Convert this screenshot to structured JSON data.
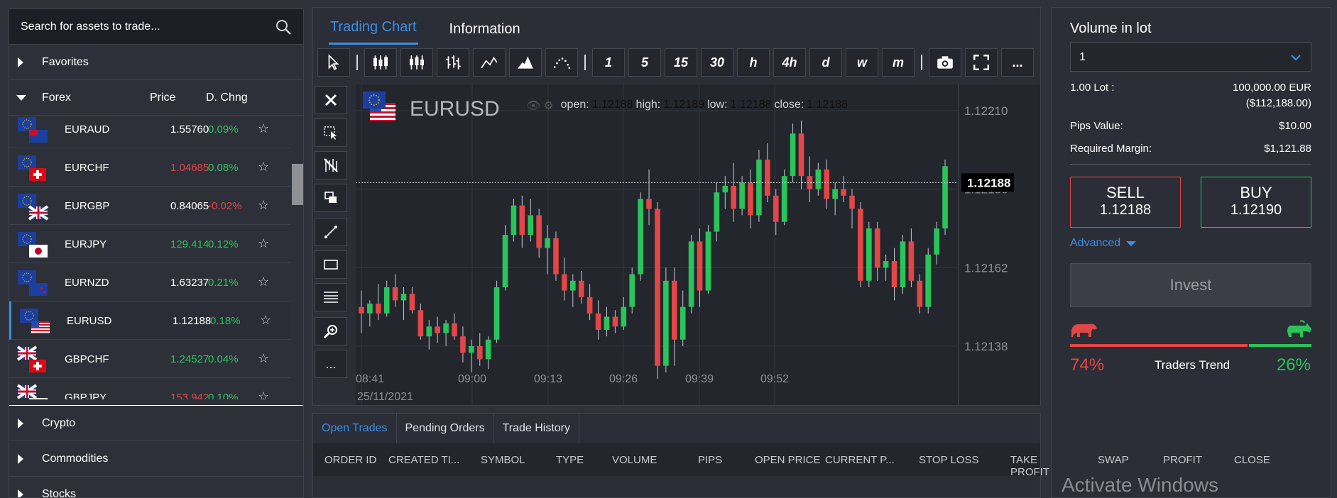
{
  "search": {
    "placeholder": "Search for assets to trade..."
  },
  "categories": {
    "favorites": "Favorites",
    "forex": "Forex",
    "crypto": "Crypto",
    "commodities": "Commodities",
    "stocks": "Stocks"
  },
  "forex_headers": {
    "price": "Price",
    "change": "D. Chng"
  },
  "forex_rows": [
    {
      "symbol": "EURAUD",
      "price": "1.55760",
      "price_color": "white",
      "change": "0.09%",
      "change_color": "green"
    },
    {
      "symbol": "EURCHF",
      "price": "1.04685",
      "price_color": "red",
      "change": "0.08%",
      "change_color": "green"
    },
    {
      "symbol": "EURGBP",
      "price": "0.84065",
      "price_color": "white",
      "change": "-0.02%",
      "change_color": "red"
    },
    {
      "symbol": "EURJPY",
      "price": "129.414",
      "price_color": "green",
      "change": "0.12%",
      "change_color": "green"
    },
    {
      "symbol": "EURNZD",
      "price": "1.63237",
      "price_color": "white",
      "change": "0.21%",
      "change_color": "green"
    },
    {
      "symbol": "EURUSD",
      "price": "1.12188",
      "price_color": "white",
      "change": "0.18%",
      "change_color": "green"
    },
    {
      "symbol": "GBPCHF",
      "price": "1.24527",
      "price_color": "green",
      "change": "0.04%",
      "change_color": "green"
    },
    {
      "symbol": "GBPJPY",
      "price": "153.942",
      "price_color": "red",
      "change": "0.10%",
      "change_color": "green"
    }
  ],
  "center_tabs": {
    "chart": "Trading Chart",
    "info": "Information"
  },
  "timeframes": [
    "1",
    "5",
    "15",
    "30",
    "h",
    "4h",
    "d",
    "w",
    "m"
  ],
  "toolbar_more": "...",
  "sidetools_more": "...",
  "chart": {
    "symbol": "EURUSD",
    "ohlc_labels": {
      "open": "open:",
      "high": "high:",
      "low": "low:",
      "close": "close:"
    },
    "ohlc_values": {
      "open": "1.12188",
      "high": "1.12189",
      "low": "1.12188",
      "close": "1.12188"
    },
    "current_price": "1.12188",
    "date_label": "25/11/2021"
  },
  "chart_data": {
    "type": "candlestick",
    "y_ticks": [
      "1.12210",
      "1.12186",
      "1.12162",
      "1.12138"
    ],
    "x_ticks": [
      "08:41",
      "09:00",
      "09:13",
      "09:26",
      "09:39",
      "09:52"
    ],
    "ylim": [
      1.1212,
      1.12218
    ],
    "candles": [
      {
        "o": 1.1215,
        "h": 1.12155,
        "l": 1.12142,
        "c": 1.12148
      },
      {
        "o": 1.12148,
        "h": 1.12152,
        "l": 1.12144,
        "c": 1.12151
      },
      {
        "o": 1.12151,
        "h": 1.12157,
        "l": 1.12146,
        "c": 1.12148
      },
      {
        "o": 1.12148,
        "h": 1.12158,
        "l": 1.12147,
        "c": 1.12156
      },
      {
        "o": 1.12156,
        "h": 1.1216,
        "l": 1.1215,
        "c": 1.12152
      },
      {
        "o": 1.12152,
        "h": 1.12156,
        "l": 1.12146,
        "c": 1.12154
      },
      {
        "o": 1.12154,
        "h": 1.12156,
        "l": 1.12148,
        "c": 1.12149
      },
      {
        "o": 1.12149,
        "h": 1.12151,
        "l": 1.1214,
        "c": 1.12141
      },
      {
        "o": 1.12141,
        "h": 1.12146,
        "l": 1.12137,
        "c": 1.12144
      },
      {
        "o": 1.12144,
        "h": 1.12147,
        "l": 1.12139,
        "c": 1.12142
      },
      {
        "o": 1.12142,
        "h": 1.12146,
        "l": 1.12138,
        "c": 1.12145
      },
      {
        "o": 1.12145,
        "h": 1.12148,
        "l": 1.1214,
        "c": 1.12141
      },
      {
        "o": 1.12141,
        "h": 1.12144,
        "l": 1.12133,
        "c": 1.12136
      },
      {
        "o": 1.12136,
        "h": 1.1214,
        "l": 1.1213,
        "c": 1.12138
      },
      {
        "o": 1.12138,
        "h": 1.12142,
        "l": 1.12132,
        "c": 1.12134
      },
      {
        "o": 1.12134,
        "h": 1.12141,
        "l": 1.12131,
        "c": 1.1214
      },
      {
        "o": 1.1214,
        "h": 1.12158,
        "l": 1.12139,
        "c": 1.12156
      },
      {
        "o": 1.12156,
        "h": 1.12175,
        "l": 1.12155,
        "c": 1.12172
      },
      {
        "o": 1.12172,
        "h": 1.12183,
        "l": 1.1217,
        "c": 1.12181
      },
      {
        "o": 1.12181,
        "h": 1.12184,
        "l": 1.12168,
        "c": 1.12172
      },
      {
        "o": 1.12172,
        "h": 1.12183,
        "l": 1.1217,
        "c": 1.12178
      },
      {
        "o": 1.12178,
        "h": 1.1218,
        "l": 1.12165,
        "c": 1.12168
      },
      {
        "o": 1.12168,
        "h": 1.12175,
        "l": 1.1216,
        "c": 1.12171
      },
      {
        "o": 1.12171,
        "h": 1.12173,
        "l": 1.12158,
        "c": 1.1216
      },
      {
        "o": 1.1216,
        "h": 1.12165,
        "l": 1.12152,
        "c": 1.12155
      },
      {
        "o": 1.12155,
        "h": 1.1216,
        "l": 1.1215,
        "c": 1.12158
      },
      {
        "o": 1.12158,
        "h": 1.12161,
        "l": 1.12151,
        "c": 1.12153
      },
      {
        "o": 1.12153,
        "h": 1.12157,
        "l": 1.12146,
        "c": 1.12148
      },
      {
        "o": 1.12148,
        "h": 1.12152,
        "l": 1.1214,
        "c": 1.12143
      },
      {
        "o": 1.12143,
        "h": 1.1215,
        "l": 1.12141,
        "c": 1.12147
      },
      {
        "o": 1.12147,
        "h": 1.12149,
        "l": 1.12142,
        "c": 1.12144
      },
      {
        "o": 1.12144,
        "h": 1.12153,
        "l": 1.12143,
        "c": 1.1215
      },
      {
        "o": 1.1215,
        "h": 1.12162,
        "l": 1.12148,
        "c": 1.1216
      },
      {
        "o": 1.1216,
        "h": 1.12185,
        "l": 1.12158,
        "c": 1.12183
      },
      {
        "o": 1.12183,
        "h": 1.12192,
        "l": 1.12175,
        "c": 1.1218
      },
      {
        "o": 1.1218,
        "h": 1.12182,
        "l": 1.12128,
        "c": 1.12132
      },
      {
        "o": 1.12132,
        "h": 1.12162,
        "l": 1.1213,
        "c": 1.12158
      },
      {
        "o": 1.12158,
        "h": 1.12162,
        "l": 1.12132,
        "c": 1.1214
      },
      {
        "o": 1.1214,
        "h": 1.12155,
        "l": 1.12138,
        "c": 1.1215
      },
      {
        "o": 1.1215,
        "h": 1.12172,
        "l": 1.12148,
        "c": 1.1217
      },
      {
        "o": 1.1217,
        "h": 1.12174,
        "l": 1.1215,
        "c": 1.12155
      },
      {
        "o": 1.12155,
        "h": 1.12175,
        "l": 1.12154,
        "c": 1.12173
      },
      {
        "o": 1.12173,
        "h": 1.12188,
        "l": 1.1217,
        "c": 1.12185
      },
      {
        "o": 1.12185,
        "h": 1.1219,
        "l": 1.1218,
        "c": 1.12187
      },
      {
        "o": 1.12187,
        "h": 1.12194,
        "l": 1.12176,
        "c": 1.1218
      },
      {
        "o": 1.1218,
        "h": 1.1219,
        "l": 1.12178,
        "c": 1.12188
      },
      {
        "o": 1.12188,
        "h": 1.12192,
        "l": 1.12174,
        "c": 1.12178
      },
      {
        "o": 1.12178,
        "h": 1.12198,
        "l": 1.12176,
        "c": 1.12195
      },
      {
        "o": 1.12195,
        "h": 1.122,
        "l": 1.12182,
        "c": 1.12184
      },
      {
        "o": 1.12184,
        "h": 1.12186,
        "l": 1.12172,
        "c": 1.12176
      },
      {
        "o": 1.12176,
        "h": 1.12192,
        "l": 1.12175,
        "c": 1.1219
      },
      {
        "o": 1.1219,
        "h": 1.12206,
        "l": 1.12188,
        "c": 1.12203
      },
      {
        "o": 1.12203,
        "h": 1.12207,
        "l": 1.12186,
        "c": 1.1219
      },
      {
        "o": 1.1219,
        "h": 1.12196,
        "l": 1.12182,
        "c": 1.12186
      },
      {
        "o": 1.12186,
        "h": 1.12194,
        "l": 1.12184,
        "c": 1.12192
      },
      {
        "o": 1.12192,
        "h": 1.12195,
        "l": 1.1218,
        "c": 1.12183
      },
      {
        "o": 1.12183,
        "h": 1.12188,
        "l": 1.12178,
        "c": 1.12186
      },
      {
        "o": 1.12186,
        "h": 1.1219,
        "l": 1.12182,
        "c": 1.12184
      },
      {
        "o": 1.12184,
        "h": 1.12186,
        "l": 1.12174,
        "c": 1.1218
      },
      {
        "o": 1.1218,
        "h": 1.12182,
        "l": 1.12156,
        "c": 1.12158
      },
      {
        "o": 1.12158,
        "h": 1.12176,
        "l": 1.12156,
        "c": 1.12174
      },
      {
        "o": 1.12174,
        "h": 1.12176,
        "l": 1.12158,
        "c": 1.12162
      },
      {
        "o": 1.12162,
        "h": 1.12166,
        "l": 1.12158,
        "c": 1.12164
      },
      {
        "o": 1.12164,
        "h": 1.12168,
        "l": 1.12152,
        "c": 1.12156
      },
      {
        "o": 1.12156,
        "h": 1.12172,
        "l": 1.12154,
        "c": 1.1217
      },
      {
        "o": 1.1217,
        "h": 1.12174,
        "l": 1.12156,
        "c": 1.12158
      },
      {
        "o": 1.12158,
        "h": 1.1216,
        "l": 1.12148,
        "c": 1.1215
      },
      {
        "o": 1.1215,
        "h": 1.12168,
        "l": 1.12148,
        "c": 1.12166
      },
      {
        "o": 1.12166,
        "h": 1.12176,
        "l": 1.12163,
        "c": 1.12174
      },
      {
        "o": 1.12174,
        "h": 1.12195,
        "l": 1.12172,
        "c": 1.12193
      }
    ]
  },
  "volume": {
    "label": "Volume in lot",
    "value": "1",
    "lot_label": "1.00 Lot :",
    "lot_value": "100,000.00 EUR",
    "lot_value_usd": "($112,188.00)",
    "pips_label": "Pips Value:",
    "pips_value": "$10.00",
    "margin_label": "Required Margin:",
    "margin_value": "$1,121.88"
  },
  "sell": {
    "label": "SELL",
    "price": "1.12188"
  },
  "buy": {
    "label": "BUY",
    "price": "1.12190"
  },
  "advanced": "Advanced",
  "invest": "Invest",
  "traders_trend": {
    "label": "Traders Trend",
    "bear_pct": "74%",
    "bull_pct": "26%",
    "bear_fraction": 0.74
  },
  "trade_tabs": [
    "Open Trades",
    "Pending Orders",
    "Trade History"
  ],
  "trade_columns": [
    "ORDER ID",
    "CREATED TI...",
    "SYMBOL",
    "TYPE",
    "VOLUME",
    "PIPS",
    "OPEN PRICE",
    "CURRENT P...",
    "STOP LOSS",
    "TAKE PROFIT",
    "SWAP",
    "PROFIT",
    "CLOSE"
  ],
  "watermark": "Activate Windows",
  "colors": {
    "green": "#29c45a",
    "red": "#e24646",
    "accent": "#3a8ee6"
  }
}
